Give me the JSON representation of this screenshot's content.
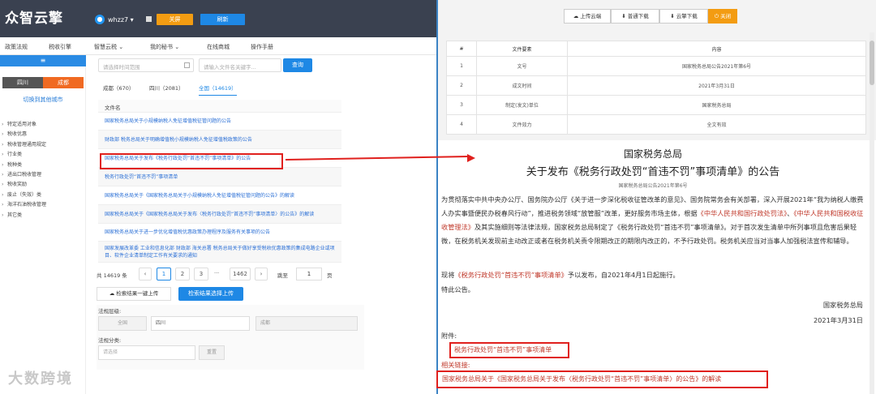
{
  "header": {
    "logo": "众智云擎",
    "user": "whzz7",
    "user_icon": "user-icon",
    "close_btn": "关屏",
    "refresh_btn": "刷新",
    "nav": [
      "政策法规",
      "税收引擎",
      "智慧云税 ⌄",
      "我的秘书 ⌄",
      "在线商城",
      "操作手册"
    ]
  },
  "sidebar": {
    "menu_icon": "≡",
    "city_a": "四川",
    "city_b": "成都",
    "switch_city": "切换到其他城市",
    "categories": [
      "特定适用对象",
      "税收优惠",
      "税收管理通用规定",
      "行业类",
      "税种类",
      "进出口税收管理",
      "税收奖励",
      "废止（失效）类",
      "海洋石油税收管理",
      "其它类"
    ]
  },
  "search": {
    "date_placeholder": "请选择时间范围",
    "keyword_placeholder": "请输入文件名关键字...",
    "query_btn": "查询"
  },
  "tabs": [
    "成都（670）",
    "四川（2081）",
    "全国（14619）"
  ],
  "file_list": {
    "header": "文件名",
    "rows": [
      "国家税务总局关于小规模纳税人免征增值税征管问题的公告",
      "财政部 税务总局关于明确增值税小规模纳税人免征增值税政策的公告",
      "国家税务总局关于发布《税务行政处罚“首违不罚”事项清单》的公告",
      "税务行政处罚“首违不罚”事项清单",
      "国家税务总局关于《国家税务总局关于小规模纳税人免征增值税征管问题的公告》的解读",
      "国家税务总局关于《国家税务总局关于发布〈税务行政处罚“首违不罚”事项清单〉的公告》的解读",
      "国家税务总局关于进一步优化增值税优惠政策办理程序及服务有关事项的公告",
      "国家发展改革委 工业和信息化部 财政部 海关总署 税务总局关于做好享受税收优惠政策的集成电路企业或项目、软件企业清单制定工作有关要求的通知"
    ]
  },
  "pager": {
    "total": "共 14619 条",
    "prev": "‹",
    "pages": [
      "1",
      "2",
      "3",
      "···",
      "1462"
    ],
    "next": "›",
    "jump_label": "跳至",
    "jump_value": "1",
    "page_unit": "页"
  },
  "actions": {
    "export_all": "检索结果一键上传",
    "export_selected": "检索结果选择上传"
  },
  "filter": {
    "level_label": "法规层级:",
    "level_value": "全国",
    "province": "四川",
    "city": "成都",
    "category_label": "法规分类:",
    "category_placeholder": "请选择",
    "reset_btn": "重置"
  },
  "watermark": "大数跨境",
  "right_toolbar": {
    "upload": "上传云端",
    "download": "普通下载",
    "cloud_download": "云擎下载",
    "close": "关闭"
  },
  "attributes": {
    "headers": [
      "#",
      "文件要素",
      "内容"
    ],
    "rows": [
      {
        "n": "1",
        "k": "文号",
        "v": "国家税务总局公告2021年第6号"
      },
      {
        "n": "2",
        "k": "成文时间",
        "v": "2021年3月31日"
      },
      {
        "n": "3",
        "k": "制定(发文)单位",
        "v": "国家税务总局"
      },
      {
        "n": "4",
        "k": "文件效力",
        "v": "全文有效"
      }
    ]
  },
  "document": {
    "org": "国家税务总局",
    "title": "关于发布《税务行政处罚“首违不罚”事项清单》的公告",
    "doc_no": "国家税务总局公告2021年第6号",
    "body_pre": "为贯彻落实中共中央办公厅、国务院办公厅《关于进一步深化税收征管改革的意见》、国务院常务会有关部署，深入开展2021年“我为纳税人缴费人办实事暨便民办税春风行动”，推进税务领域“放管服”改革，更好服务市场主体，根据",
    "law1": "《中华人民共和国行政处罚法》",
    "body_mid": "、",
    "law2": "《中华人民共和国税收征收管理法》",
    "body_post": "及其实施细则等法律法规，国家税务总局制定了《税务行政处罚“首违不罚”事项清单》。对于首次发生清单中所列事项且危害后果轻微，在税务机关发现前主动改正或者在税务机关责令限期改正的期限内改正的，不予行政处罚。税务机关应当对当事人加强税法宣传和辅导。",
    "p2_pre": "现将",
    "p2_link": "《税务行政处罚“首违不罚”事项清单》",
    "p2_post": "予以发布，自2021年4月1日起施行。",
    "p3": "特此公告。",
    "sign_org": "国家税务总局",
    "sign_date": "2021年3月31日",
    "attachment_label": "附件:",
    "attachment_link": "税务行政处罚“首违不罚”事项清单",
    "related_label": "相关链接:",
    "related_link": "国家税务总局关于《国家税务总局关于发布〈税务行政处罚“首违不罚”事项清单〉的公告》的解读"
  }
}
